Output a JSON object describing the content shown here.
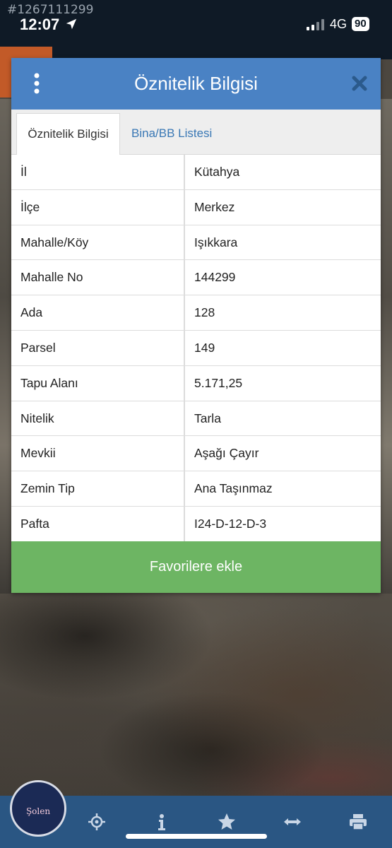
{
  "status_bar": {
    "watermark_id": "#1267111299",
    "time": "12:07",
    "network": "4G",
    "battery": "90"
  },
  "dialog": {
    "title": "Öznitelik Bilgisi",
    "tabs": [
      {
        "label": "Öznitelik Bilgisi",
        "active": true
      },
      {
        "label": "Bina/BB Listesi",
        "active": false
      }
    ],
    "rows": [
      {
        "key": "İl",
        "value": "Kütahya"
      },
      {
        "key": "İlçe",
        "value": "Merkez"
      },
      {
        "key": "Mahalle/Köy",
        "value": "Işıkkara"
      },
      {
        "key": "Mahalle No",
        "value": "144299"
      },
      {
        "key": "Ada",
        "value": "128"
      },
      {
        "key": "Parsel",
        "value": "149"
      },
      {
        "key": "Tapu Alanı",
        "value": "5.171,25"
      },
      {
        "key": "Nitelik",
        "value": "Tarla"
      },
      {
        "key": "Mevkii",
        "value": "Aşağı Çayır"
      },
      {
        "key": "Zemin Tip",
        "value": "Ana Taşınmaz"
      },
      {
        "key": "Pafta",
        "value": "I24-D-12-D-3"
      }
    ],
    "favorite_button": "Favorilere ekle"
  },
  "toolbar": {
    "icons": [
      "locate-icon",
      "info-icon",
      "star-icon",
      "measure-icon",
      "print-icon"
    ]
  },
  "brand": {
    "logo_text": "Şolen"
  },
  "colors": {
    "header": "#4a82c4",
    "favorite_button": "#6db563",
    "toolbar": "#2a5683",
    "tab_link": "#3a78b5"
  }
}
